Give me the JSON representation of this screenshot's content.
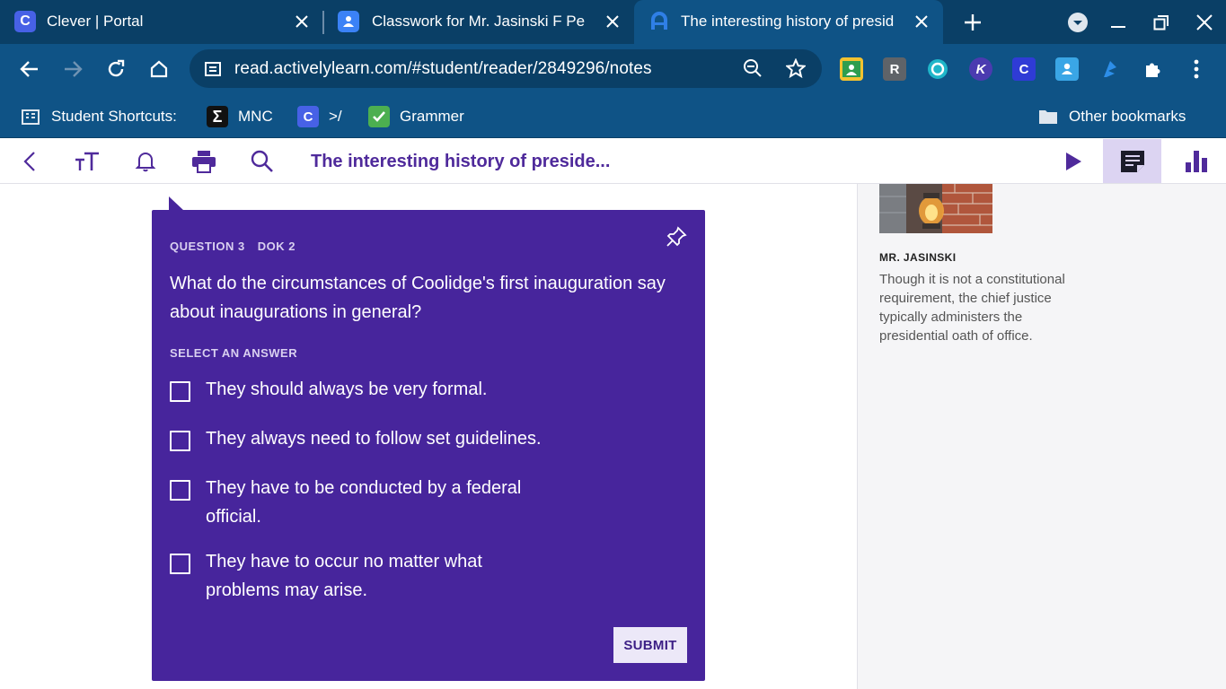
{
  "browser": {
    "tabs": [
      {
        "title": "Clever | Portal",
        "favicon": "C",
        "favicon_color": "#4761e6",
        "active": false
      },
      {
        "title": "Classwork for Mr. Jasinski F Pe",
        "favicon": "classroom-icon",
        "favicon_color": "#3b82f6",
        "active": false
      },
      {
        "title": "The interesting history of presid",
        "favicon": "actively-learn-icon",
        "favicon_color": "#1e6fd8",
        "active": true
      }
    ],
    "url": "read.activelylearn.com/#student/reader/2849296/notes",
    "extensions": [
      {
        "name": "classroom-extension-icon",
        "label": "",
        "color": "#2e9e4f"
      },
      {
        "name": "r-extension-icon",
        "label": "R",
        "color": "#5f6368"
      },
      {
        "name": "shield-extension-icon",
        "label": "",
        "color": "#1fb6c9"
      },
      {
        "name": "k-extension-icon",
        "label": "K",
        "color": "#4b3bb0"
      },
      {
        "name": "clever-extension-icon",
        "label": "C",
        "color": "#2f3bd6"
      },
      {
        "name": "profile-extension-icon",
        "label": "",
        "color": "#3aa6e6"
      },
      {
        "name": "feather-extension-icon",
        "label": "",
        "color": "#2d8ee8"
      }
    ],
    "bookmarks": [
      {
        "label": "Student Shortcuts:",
        "icon": "building-icon"
      },
      {
        "label": "MNC",
        "icon": "sigma-icon"
      },
      {
        "label": ">/",
        "icon": "clever-icon"
      },
      {
        "label": "Grammer",
        "icon": "check-icon"
      }
    ],
    "other_bookmarks": "Other bookmarks"
  },
  "app": {
    "title": "The interesting history of preside...",
    "accent": "#4f2a9b"
  },
  "question": {
    "number": "QUESTION 3",
    "dok": "DOK 2",
    "text": "What do the circumstances of Coolidge's first inauguration say about inaugurations in general?",
    "select_label": "SELECT AN ANSWER",
    "options": [
      "They should always be very formal.",
      "They always need to follow set guidelines.",
      "They have to be conducted by a federal official.",
      "They have to occur no matter what problems may arise."
    ],
    "submit_label": "SUBMIT",
    "card_color": "#47259c"
  },
  "note": {
    "author": "MR. JASINSKI",
    "text": "Though it is not a constitutional requirement, the chief justice typically administers the presidential oath of office."
  }
}
